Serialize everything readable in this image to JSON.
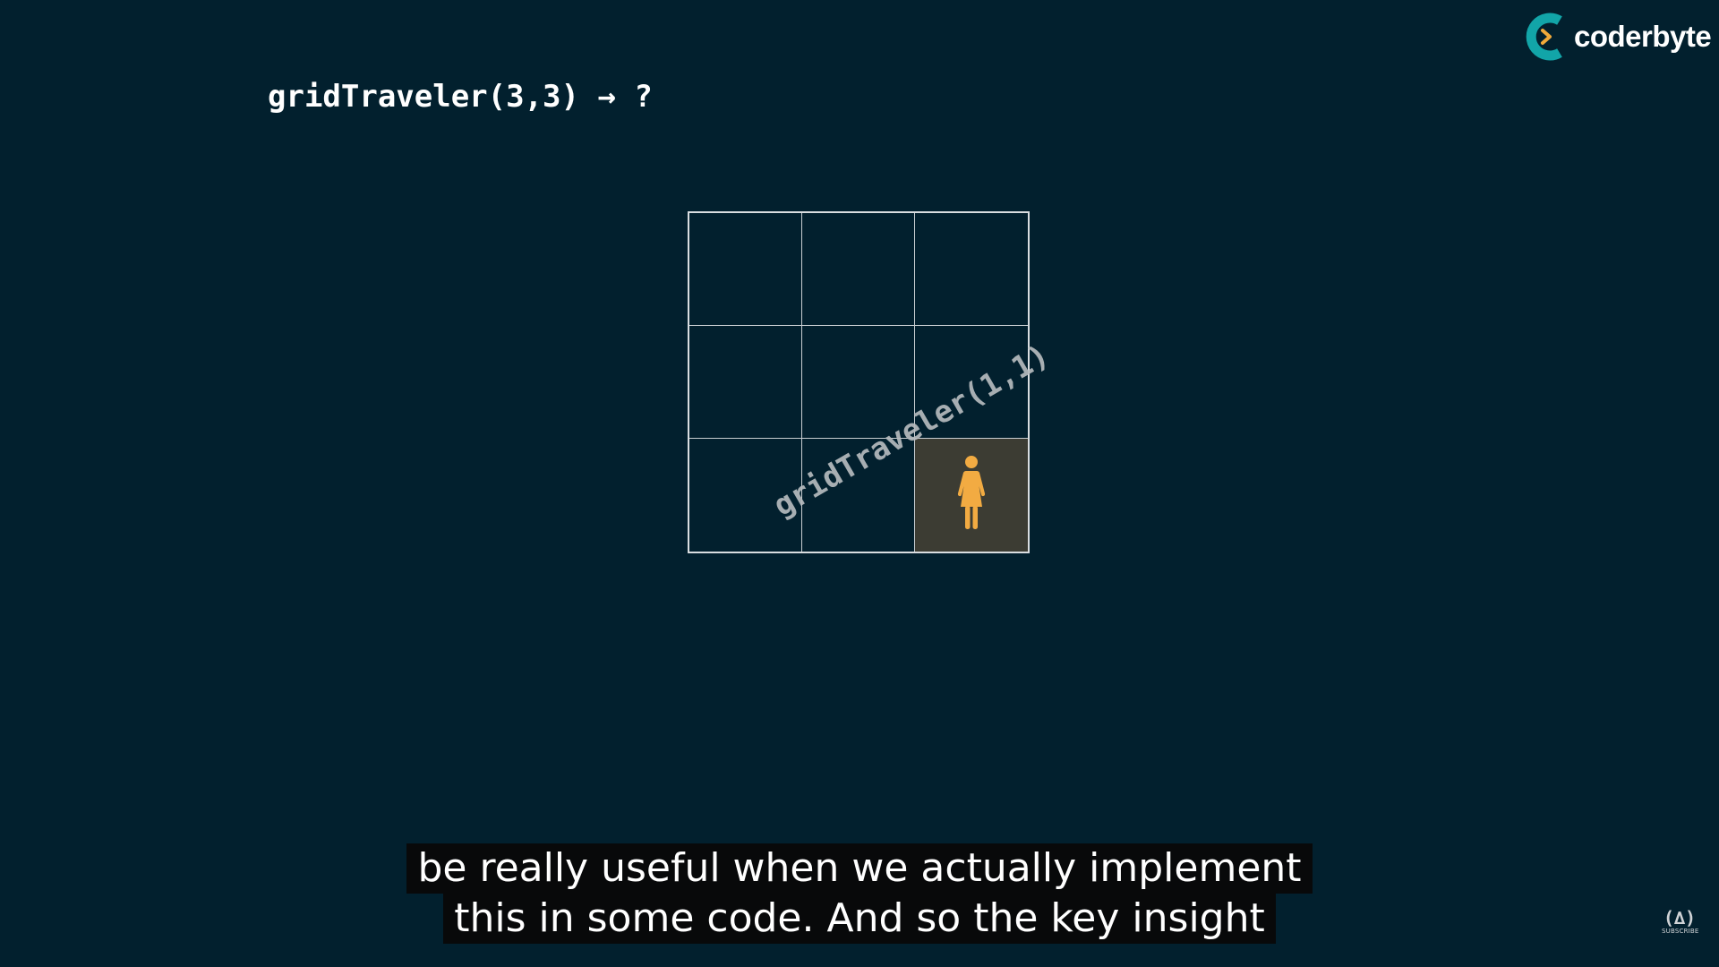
{
  "logo": {
    "text": "coderbyte",
    "icon": "coderbyte-logo-icon",
    "colors": {
      "ring": "#12a5a8",
      "chevron": "#f0a93a"
    }
  },
  "title": {
    "expression": "gridTraveler(3,3) → ?"
  },
  "grid": {
    "rows": 3,
    "cols": 3,
    "active_cell": {
      "row": 3,
      "col": 3
    },
    "active_icon": "woman-figure-icon",
    "active_icon_color": "#f2ab42",
    "diagonal_label": "gridTraveler(1,1)"
  },
  "subtitles": {
    "line1": "be really useful when we actually implement",
    "line2": "this in some code. And so the key insight"
  },
  "fcc_mark": {
    "glyph": "(∆)",
    "caption": "SUBSCRIBE",
    "icon": "freecodecamp-fire-icon"
  },
  "colors": {
    "background": "#02202e",
    "grid_line": "#d9dde0",
    "active_cell_bg": "#3c3c33"
  }
}
